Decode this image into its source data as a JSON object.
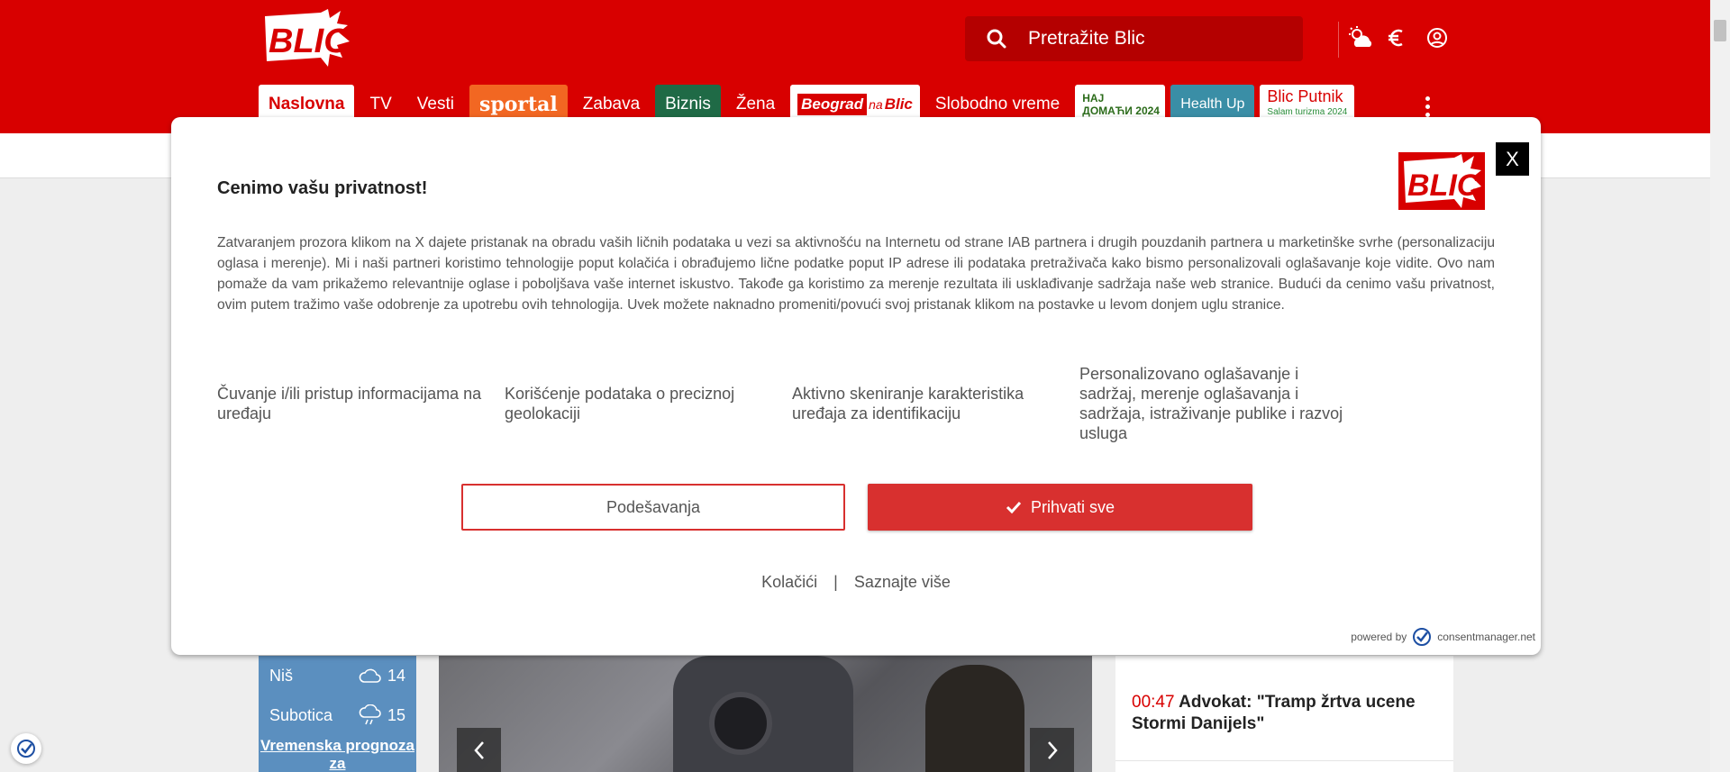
{
  "header": {
    "logo_text": "BLIC",
    "search_placeholder": "Pretražite Blic",
    "icons": [
      "weather-icon",
      "currency-euro-icon",
      "user-account-icon"
    ]
  },
  "nav": {
    "items": [
      {
        "label": "Naslovna",
        "active": true
      },
      {
        "label": "TV"
      },
      {
        "label": "Vesti"
      },
      {
        "label": "sportal"
      },
      {
        "label": "Zabava"
      },
      {
        "label": "Biznis"
      },
      {
        "label": "Žena"
      },
      {
        "label_part1": "Beograd",
        "label_part2": "na",
        "label_part3": "Blic"
      },
      {
        "label": "Slobodno vreme"
      },
      {
        "label_line1": "НАЈ",
        "label_line2": "ДОМАЋИ 2024"
      },
      {
        "label": "Health Up"
      },
      {
        "label_line1": "Blic Putnik",
        "label_line2": "Salam turizma 2024"
      }
    ]
  },
  "weather": {
    "rows": [
      {
        "city": "Niš",
        "temp": "14"
      },
      {
        "city": "Subotica",
        "temp": "15"
      }
    ],
    "link": "Vremenska prognoza za"
  },
  "news": {
    "time": "00:47",
    "headline": "Advokat: \"Tramp žrtva ucene Stormi Danijels\""
  },
  "consent": {
    "close_label": "X",
    "logo_text": "BLIC",
    "title": "Cenimo vašu privatnost!",
    "body": "Zatvaranjem prozora klikom na X dajete pristanak na obradu vaših ličnih podataka u vezi sa aktivnošću na Internetu od strane IAB partnera i drugih pouzdanih partnera u marketinške svrhe (personalizaciju oglasa i merenje). Mi i naši partneri koristimo tehnologije poput kolačića i obrađujemo lične podatke poput IP adrese ili podataka pretraživača kako bismo personalizovali oglašavanje koje vidite. Ovo nam pomaže da vam prikažemo relevantnije oglase i poboljšava vaše internet iskustvo. Takođe ga koristimo za merenje rezultata ili usklađivanje sadržaja naše web stranice. Budući da cenimo vašu privatnost, ovim putem tražimo vaše odobrenje za upotrebu ovih tehnologija. Uvek možete naknadno promeniti/povući svoj pristanak klikom na postavke u levom donjem uglu stranice.",
    "purposes": [
      "Čuvanje i/ili pristup informacijama na uređaju",
      "Korišćenje podataka o preciznoj geolokaciji",
      "Aktivno skeniranje karakteristika uređaja za identifikaciju",
      "Personalizovano oglašavanje i sadržaj, merenje oglašavanja i sadržaja, istraživanje publike i razvoj usluga"
    ],
    "settings_label": "Podešavanja",
    "accept_label": "Prihvati sve",
    "link_cookies": "Kolačići",
    "link_separator": "|",
    "link_more": "Saznajte više",
    "powered_by": "powered by",
    "provider": "consentmanager.net"
  },
  "colors": {
    "brand_red": "#d80000",
    "accept_red": "#d8302f",
    "sportal_orange": "#f26722",
    "biznis_green": "#1f6a46",
    "health_blue": "#3a8ea6"
  }
}
